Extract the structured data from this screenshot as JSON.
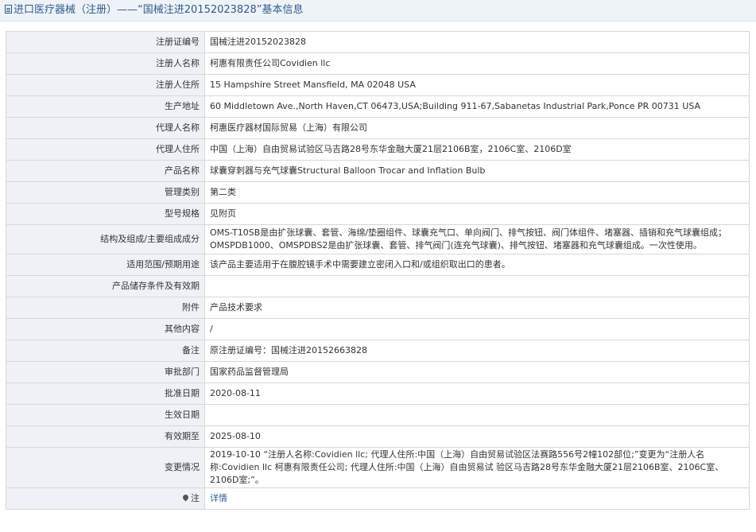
{
  "title": {
    "prefix": "进口医疗器械（注册）",
    "separator": "——",
    "name": "“国械注进20152023828”",
    "suffix": "基本信息"
  },
  "rows": [
    {
      "label": "注册证编号",
      "value": "国械注进20152023828"
    },
    {
      "label": "注册人名称",
      "value": "柯惠有限责任公司Covidien llc"
    },
    {
      "label": "注册人住所",
      "value": "15 Hampshire Street Mansfield, MA 02048 USA"
    },
    {
      "label": "生产地址",
      "value": "60 Middletown Ave.,North Haven,CT 06473,USA;Building 911-67,Sabanetas Industrial Park,Ponce PR 00731 USA"
    },
    {
      "label": "代理人名称",
      "value": "柯惠医疗器材国际贸易（上海）有限公司"
    },
    {
      "label": "代理人住所",
      "value": "中国（上海）自由贸易试验区马吉路28号东华金融大厦21层2106B室，2106C室、2106D室"
    },
    {
      "label": "产品名称",
      "value": "球囊穿刺器与充气球囊Structural Balloon Trocar and Inflation Bulb"
    },
    {
      "label": "管理类别",
      "value": "第二类"
    },
    {
      "label": "型号规格",
      "value": "见附页"
    },
    {
      "label": "结构及组成/主要组成成分",
      "value": "OMS-T10SB是由扩张球囊、套管、海绵/垫圈组件、球囊充气口、单向阀门、排气按钮、阀门体组件、堵塞器、插销和充气球囊组成；OMSPDB1000、OMSPDBS2是由扩张球囊、套管、排气阀门(连充气球囊)、排气按钮、堵塞器和充气球囊组成。一次性使用。"
    },
    {
      "label": "适用范围/预期用途",
      "value": "该产品主要适用于在腹腔镜手术中需要建立密闭入口和/或组织取出口的患者。"
    },
    {
      "label": "产品储存条件及有效期",
      "value": ""
    },
    {
      "label": "附件",
      "value": "产品技术要求"
    },
    {
      "label": "其他内容",
      "value": "/"
    },
    {
      "label": "备注",
      "value": "原注册证编号：国械注进20152663828"
    },
    {
      "label": "审批部门",
      "value": "国家药品监督管理局"
    },
    {
      "label": "批准日期",
      "value": "2020-08-11"
    },
    {
      "label": "生效日期",
      "value": ""
    },
    {
      "label": "有效期至",
      "value": "2025-08-10"
    },
    {
      "label": "变更情况",
      "value": "2019-10-10 “注册人名称:Covidien llc; 代理人住所:中国（上海）自由贸易试验区法赛路556号2幢102部位;”变更为“注册人名称:Covidien llc 柯惠有限责任公司; 代理人住所:中国（上海）自由贸易试 验区马吉路28号东华金融大厦21层2106B室、2106C室、2106D室;”。"
    }
  ],
  "note": {
    "label": "注",
    "link": "详情"
  },
  "colors": {
    "label_bg": "#eef2f6",
    "title_color": "#2f5d8a",
    "border": "#d8d8d8"
  }
}
